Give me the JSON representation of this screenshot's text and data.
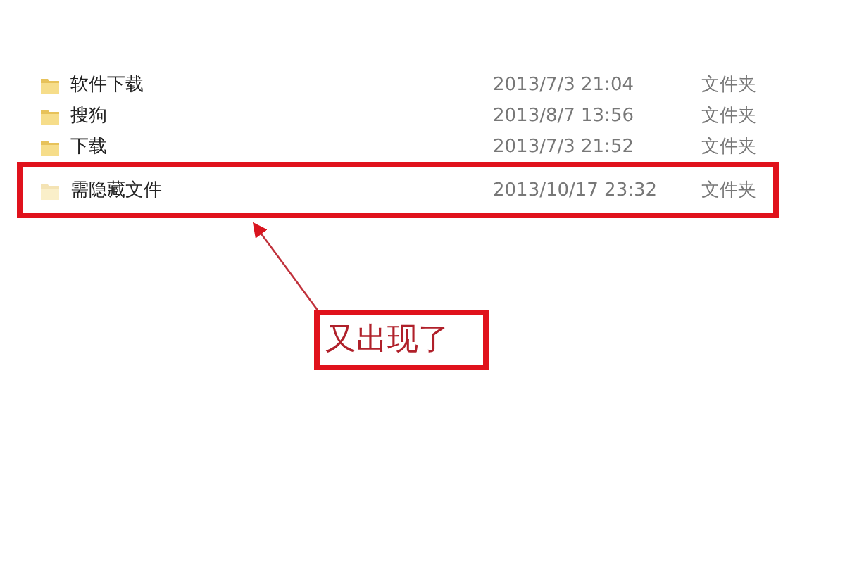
{
  "files": [
    {
      "name": "软件下载",
      "modified": "2013/7/3 21:04",
      "type": "文件夹",
      "hidden": false,
      "highlighted": false
    },
    {
      "name": "搜狗",
      "modified": "2013/8/7 13:56",
      "type": "文件夹",
      "hidden": false,
      "highlighted": false
    },
    {
      "name": "下载",
      "modified": "2013/7/3 21:52",
      "type": "文件夹",
      "hidden": false,
      "highlighted": false
    },
    {
      "name": "需隐藏文件",
      "modified": "2013/10/17 23:32",
      "type": "文件夹",
      "hidden": true,
      "highlighted": true
    }
  ],
  "annotation": {
    "text": "又出现了"
  }
}
